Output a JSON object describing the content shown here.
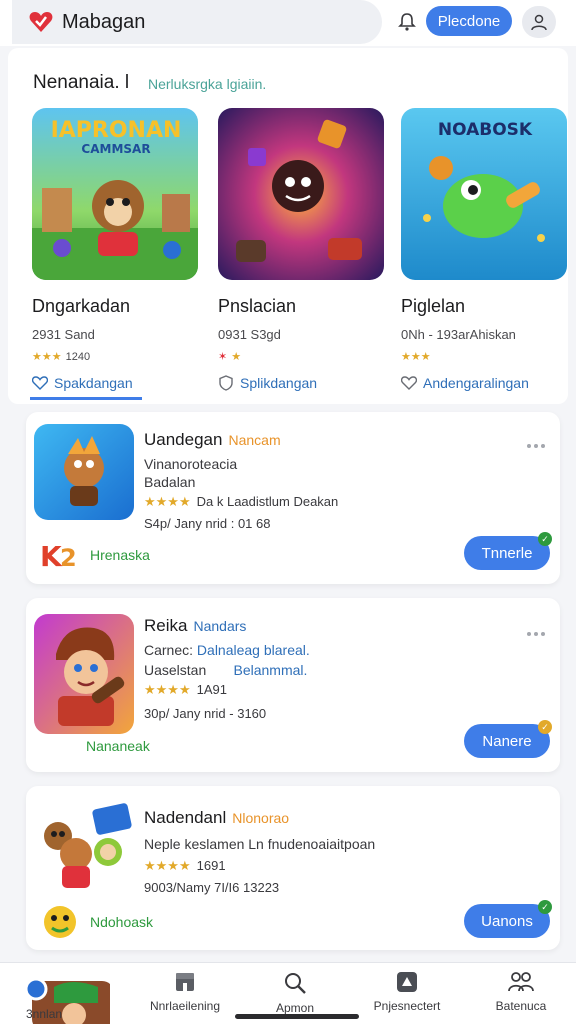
{
  "header": {
    "brand_name": "Mabagan",
    "primary_button": "Plecdone"
  },
  "featured": {
    "title": "Nenanaia. l",
    "subtitle": "Nerluksrgka lgiaiin.",
    "apps": [
      {
        "art_text_top": "IAPRONAN",
        "art_text_bottom": "CAMMSAR",
        "name": "Dngarkadan",
        "meta": "2931 Sand",
        "rating": "1240",
        "link": "Spakdangan"
      },
      {
        "art_text_top": "",
        "art_text_bottom": "",
        "name": "Pnslacian",
        "meta": "0931 S3gd",
        "rating": "",
        "link": "Splikdangan"
      },
      {
        "art_text_top": "NOABOSK",
        "art_text_bottom": "",
        "name": "Piglelan",
        "meta": "0Nh - 193arAhiskan",
        "rating": "",
        "link": "Andengaralingan"
      }
    ]
  },
  "list": [
    {
      "name": "Uandegan",
      "tag": "Nancam",
      "tag_color": "#e8932a",
      "line1": "Vinanoroteacia",
      "line1_hl": "",
      "line2": "Badalan",
      "line2_hl": "",
      "rating": "Da k Laadistlum Deakan",
      "meta": "S4p/ Jany nrid : 01 68",
      "developer": "Hrenaska",
      "install": "Tnnerle",
      "badge_color": "#2e9a3e"
    },
    {
      "name": "Reika",
      "tag": "Nandars",
      "tag_color": "#2f6fb8",
      "line1": "Carnec:",
      "line1_hl": "Dalnaleag blareal.",
      "line2": "Uaselstan",
      "line2_hl": "Belanmmal.",
      "rating": "1A91",
      "meta": "30p/ Jany nrid - 3160",
      "developer": "Nananeak",
      "install": "Nanere",
      "badge_color": "#e2a92a"
    },
    {
      "name": "Nadendanl",
      "tag": "Nlonorao",
      "tag_color": "#e8932a",
      "line1": "Neple keslamen Ln fnudenoaiaitpoan",
      "line1_hl": "",
      "line2": "",
      "line2_hl": "",
      "rating": "1691",
      "meta": "9003/Namy 7I/I6 13223",
      "developer": "Ndohoask",
      "install": "Uanons",
      "badge_color": "#2e9a3e"
    }
  ],
  "nav": [
    {
      "icon": "home-icon",
      "label": "3nnlan"
    },
    {
      "icon": "store-icon",
      "label": "Nnrlaeilening"
    },
    {
      "icon": "search-icon",
      "label": "Apmon"
    },
    {
      "icon": "apps-icon",
      "label": "Pnjesnectert"
    },
    {
      "icon": "people-icon",
      "label": "Batenuca"
    }
  ]
}
